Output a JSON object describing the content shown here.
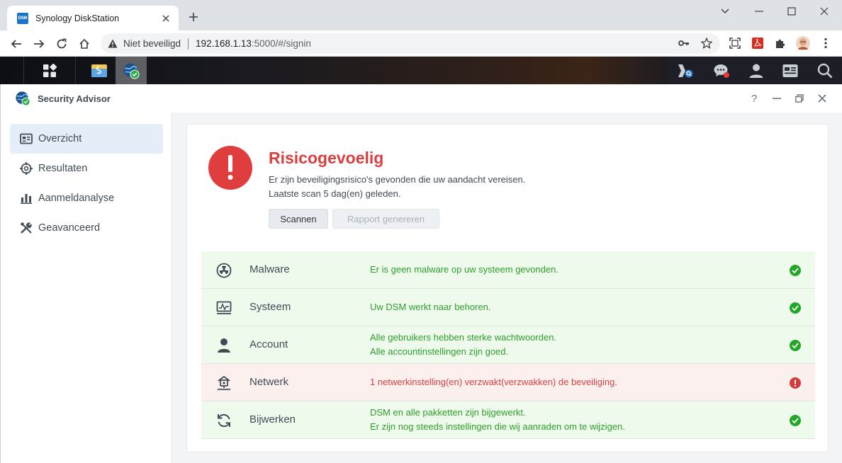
{
  "browser": {
    "tab_favicon_text": "DSM",
    "tab_title": "Synology DiskStation",
    "not_secure_label": "Niet beveiligd",
    "url_host": "192.168.1.13",
    "url_rest": ":5000/#/signin"
  },
  "window": {
    "title": "Security Advisor",
    "help_label": "?"
  },
  "sidebar": {
    "items": [
      {
        "label": "Overzicht",
        "icon": "overview-icon",
        "active": true
      },
      {
        "label": "Resultaten",
        "icon": "target-icon",
        "active": false
      },
      {
        "label": "Aanmeldanalyse",
        "icon": "bar-chart-icon",
        "active": false
      },
      {
        "label": "Geavanceerd",
        "icon": "tools-icon",
        "active": false
      }
    ]
  },
  "overview": {
    "status_title": "Risicogevoelig",
    "status_description": "Er zijn beveiligingsrisico's gevonden die uw aandacht vereisen.",
    "last_scan": "Laatste scan 5 dag(en) geleden.",
    "scan_button": "Scannen",
    "report_button": "Rapport genereren"
  },
  "results": [
    {
      "name": "Malware",
      "icon": "radiation-icon",
      "status": "ok",
      "lines": [
        "Er is geen malware op uw systeem gevonden."
      ]
    },
    {
      "name": "Systeem",
      "icon": "monitor-icon",
      "status": "ok",
      "lines": [
        "Uw DSM werkt naar behoren."
      ]
    },
    {
      "name": "Account",
      "icon": "user-icon",
      "status": "ok",
      "lines": [
        "Alle gebruikers hebben sterke wachtwoorden.",
        "Alle accountinstellingen zijn goed."
      ]
    },
    {
      "name": "Netwerk",
      "icon": "network-icon",
      "status": "warning",
      "lines": [
        "1 netwerkinstelling(en) verzwakt(verzwakken) de beveiliging."
      ]
    },
    {
      "name": "Bijwerken",
      "icon": "refresh-icon",
      "status": "ok",
      "lines": [
        "DSM en alle pakketten zijn bijgewerkt.",
        "Er zijn nog steeds instellingen die wij aanraden om te wijzigen."
      ]
    }
  ],
  "colors": {
    "danger": "#e03e3e",
    "ok_green": "#22a728",
    "ok_row_bg": "#eefbec",
    "bad_row_bg": "#fcf0ef",
    "active_sidebar_bg": "#e4eef9"
  }
}
